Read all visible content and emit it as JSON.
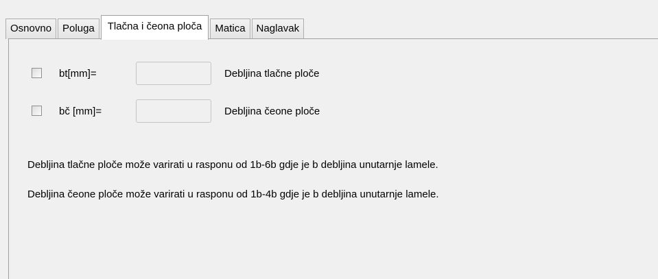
{
  "tabs": [
    {
      "label": "Osnovno",
      "active": false
    },
    {
      "label": "Poluga",
      "active": false
    },
    {
      "label": "Tlačna i čeona ploča",
      "active": true
    },
    {
      "label": "Matica",
      "active": false
    },
    {
      "label": "Naglavak",
      "active": false
    }
  ],
  "fields": [
    {
      "checked": false,
      "label": "bt[mm]=",
      "value": "",
      "description": "Debljina tlačne ploče"
    },
    {
      "checked": false,
      "label": "bč [mm]=",
      "value": "",
      "description": "Debljina čeone ploče"
    }
  ],
  "notes": [
    "Debljina tlačne ploče može varirati u rasponu od 1b-6b gdje je b debljina unutarnje lamele.",
    "Debljina čeone ploče može varirati u rasponu od 1b-4b gdje je b debljina unutarnje lamele."
  ]
}
